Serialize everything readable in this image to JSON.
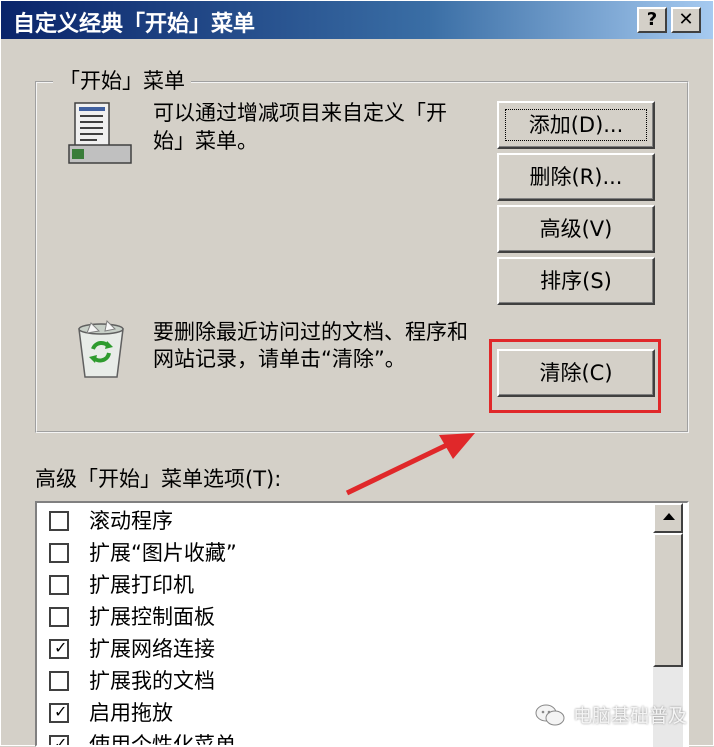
{
  "window": {
    "title": "自定义经典「开始」菜单",
    "help_label": "?",
    "close_label": "✕"
  },
  "start_menu_group": {
    "label": "「开始」菜单",
    "description": "可以通过增减项目来自定义「开始」菜单。",
    "buttons": {
      "add": "添加(D)...",
      "delete": "删除(R)...",
      "advanced": "高级(V)",
      "sort": "排序(S)"
    },
    "clear_description": "要删除最近访问过的文档、程序和网站记录，请单击“清除”。",
    "clear_button": "清除(C)"
  },
  "advanced_options": {
    "label": "高级「开始」菜单选项(T):",
    "items": [
      {
        "label": "滚动程序",
        "checked": false
      },
      {
        "label": "扩展“图片收藏”",
        "checked": false
      },
      {
        "label": "扩展打印机",
        "checked": false
      },
      {
        "label": "扩展控制面板",
        "checked": false
      },
      {
        "label": "扩展网络连接",
        "checked": true
      },
      {
        "label": "扩展我的文档",
        "checked": false
      },
      {
        "label": "启用拖放",
        "checked": true
      },
      {
        "label": "使用个性化菜单",
        "checked": true
      }
    ]
  },
  "watermark": {
    "text": "电脑基础普及"
  },
  "colors": {
    "highlight_box": "#e0282a",
    "title_bar": "#0a246a",
    "dialog_bg": "#d4d0c8"
  },
  "icons": {
    "start_menu": "start-menu-document-icon",
    "recycle_bin": "recycle-bin-icon",
    "watermark": "wechat-icon"
  }
}
